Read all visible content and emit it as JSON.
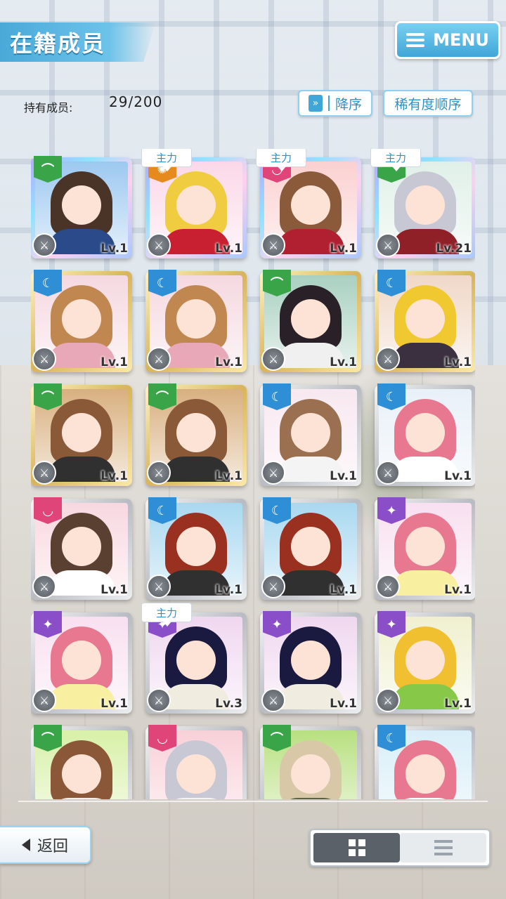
{
  "header": {
    "title": "在籍成员",
    "menu_label": "MENU"
  },
  "owned": {
    "label": "持有成员:",
    "value": "29/200"
  },
  "sort": {
    "order_label": "降序",
    "order_icon": "double-chevron-down-icon",
    "rarity_label": "稀有度顺序"
  },
  "main_tag_label": "主力",
  "cards": [
    {
      "frame": "rainbow",
      "attr": "green",
      "level": "Lv.1",
      "main": false,
      "hair": "#4a3428",
      "outfit": "#2a4a8a",
      "bg": "#9cc8f0"
    },
    {
      "frame": "rainbow",
      "attr": "orange",
      "level": "Lv.1",
      "main": true,
      "hair": "#f0cc40",
      "outfit": "#c82030",
      "bg": "#fbd8e8"
    },
    {
      "frame": "rainbow",
      "attr": "pink",
      "level": "Lv.1",
      "main": true,
      "hair": "#8a5a3a",
      "outfit": "#b02030",
      "bg": "#fbd0d0"
    },
    {
      "frame": "rainbow",
      "attr": "green",
      "level": "Lv.21",
      "main": true,
      "hair": "#c8c8d4",
      "outfit": "#902028",
      "bg": "#e0f0e8"
    },
    {
      "frame": "gold",
      "attr": "blue",
      "level": "Lv.1",
      "main": false,
      "hair": "#c08850",
      "outfit": "#e8a8b8",
      "bg": "#f5d8e0"
    },
    {
      "frame": "gold",
      "attr": "blue",
      "level": "Lv.1",
      "main": false,
      "hair": "#c08850",
      "outfit": "#e8a8b8",
      "bg": "#f5d8e0"
    },
    {
      "frame": "gold",
      "attr": "green",
      "level": "Lv.1",
      "main": false,
      "hair": "#2a2028",
      "outfit": "#f0f0f0",
      "bg": "#a8d0c0"
    },
    {
      "frame": "gold",
      "attr": "blue",
      "level": "Lv.1",
      "main": false,
      "hair": "#f0c830",
      "outfit": "#3a3040",
      "bg": "#f0d8c8"
    },
    {
      "frame": "gold",
      "attr": "green",
      "level": "Lv.1",
      "main": false,
      "hair": "#8a5a38",
      "outfit": "#303030",
      "bg": "#d8b080"
    },
    {
      "frame": "gold",
      "attr": "green",
      "level": "Lv.1",
      "main": false,
      "hair": "#8a5a38",
      "outfit": "#303030",
      "bg": "#d8b080"
    },
    {
      "frame": "silver",
      "attr": "blue",
      "level": "Lv.1",
      "main": false,
      "hair": "#9a7050",
      "outfit": "#f4f4f4",
      "bg": "#f8e8f0"
    },
    {
      "frame": "silver",
      "attr": "blue",
      "level": "Lv.1",
      "main": false,
      "hair": "#e87890",
      "outfit": "#ffffff",
      "bg": "#e8f0f8"
    },
    {
      "frame": "silver",
      "attr": "pink",
      "level": "Lv.1",
      "main": false,
      "hair": "#5a4030",
      "outfit": "#ffffff",
      "bg": "#f8d8e0"
    },
    {
      "frame": "silver",
      "attr": "blue",
      "level": "Lv.1",
      "main": false,
      "hair": "#9a3020",
      "outfit": "#303030",
      "bg": "#a8d8f0"
    },
    {
      "frame": "silver",
      "attr": "blue",
      "level": "Lv.1",
      "main": false,
      "hair": "#9a3020",
      "outfit": "#303030",
      "bg": "#a8d8f0"
    },
    {
      "frame": "silver",
      "attr": "purple",
      "level": "Lv.1",
      "main": false,
      "hair": "#e87890",
      "outfit": "#f8f0a0",
      "bg": "#f8e0f0"
    },
    {
      "frame": "silver",
      "attr": "purple",
      "level": "Lv.1",
      "main": false,
      "hair": "#e87890",
      "outfit": "#f8f0a0",
      "bg": "#f8e0f0"
    },
    {
      "frame": "silver",
      "attr": "purple",
      "level": "Lv.3",
      "main": true,
      "hair": "#1a1a40",
      "outfit": "#f0ece0",
      "bg": "#f0d8f0"
    },
    {
      "frame": "silver",
      "attr": "purple",
      "level": "Lv.1",
      "main": false,
      "hair": "#1a1a40",
      "outfit": "#f0ece0",
      "bg": "#f0d8f0"
    },
    {
      "frame": "silver",
      "attr": "purple",
      "level": "Lv.1",
      "main": false,
      "hair": "#f0c030",
      "outfit": "#88c848",
      "bg": "#f0f0d0"
    },
    {
      "frame": "silver",
      "attr": "green",
      "level": "",
      "main": false,
      "hair": "#8a5838",
      "outfit": "#f8f0e8",
      "bg": "#d8f0a8"
    },
    {
      "frame": "silver",
      "attr": "pink",
      "level": "",
      "main": false,
      "hair": "#c8c8d4",
      "outfit": "#f4f4f4",
      "bg": "#f8d0d8"
    },
    {
      "frame": "silver",
      "attr": "green",
      "level": "",
      "main": false,
      "hair": "#d8c8a8",
      "outfit": "#5a6040",
      "bg": "#b8e080"
    },
    {
      "frame": "silver",
      "attr": "blue",
      "level": "",
      "main": false,
      "hair": "#e87890",
      "outfit": "#ffffff",
      "bg": "#d8eef8"
    }
  ],
  "footer": {
    "back_label": "返回"
  },
  "view_toggle": {
    "active": "grid"
  }
}
